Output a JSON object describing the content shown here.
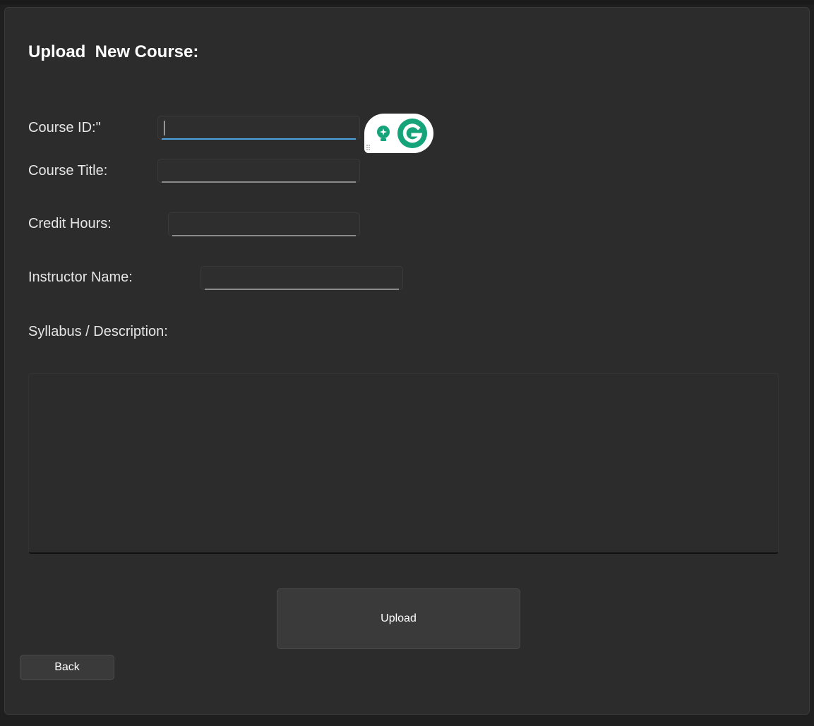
{
  "form": {
    "title": "Upload  New Course:",
    "fields": {
      "course_id": {
        "label": "Course ID:\"",
        "value": ""
      },
      "course_title": {
        "label": "Course Title:",
        "value": ""
      },
      "credit_hours": {
        "label": "Credit Hours:",
        "value": ""
      },
      "instructor_name": {
        "label": "Instructor Name:",
        "value": ""
      },
      "syllabus": {
        "label": "Syllabus / Description:",
        "value": ""
      }
    },
    "upload_label": "Upload",
    "back_label": "Back"
  },
  "grammarly": {
    "icons": [
      "lightbulb-icon",
      "grammarly-g-icon"
    ],
    "accent": "#15a37a"
  },
  "colors": {
    "background": "#2c2c2c",
    "focus_underline": "#4aa3df",
    "text": "#e6e6e6"
  }
}
